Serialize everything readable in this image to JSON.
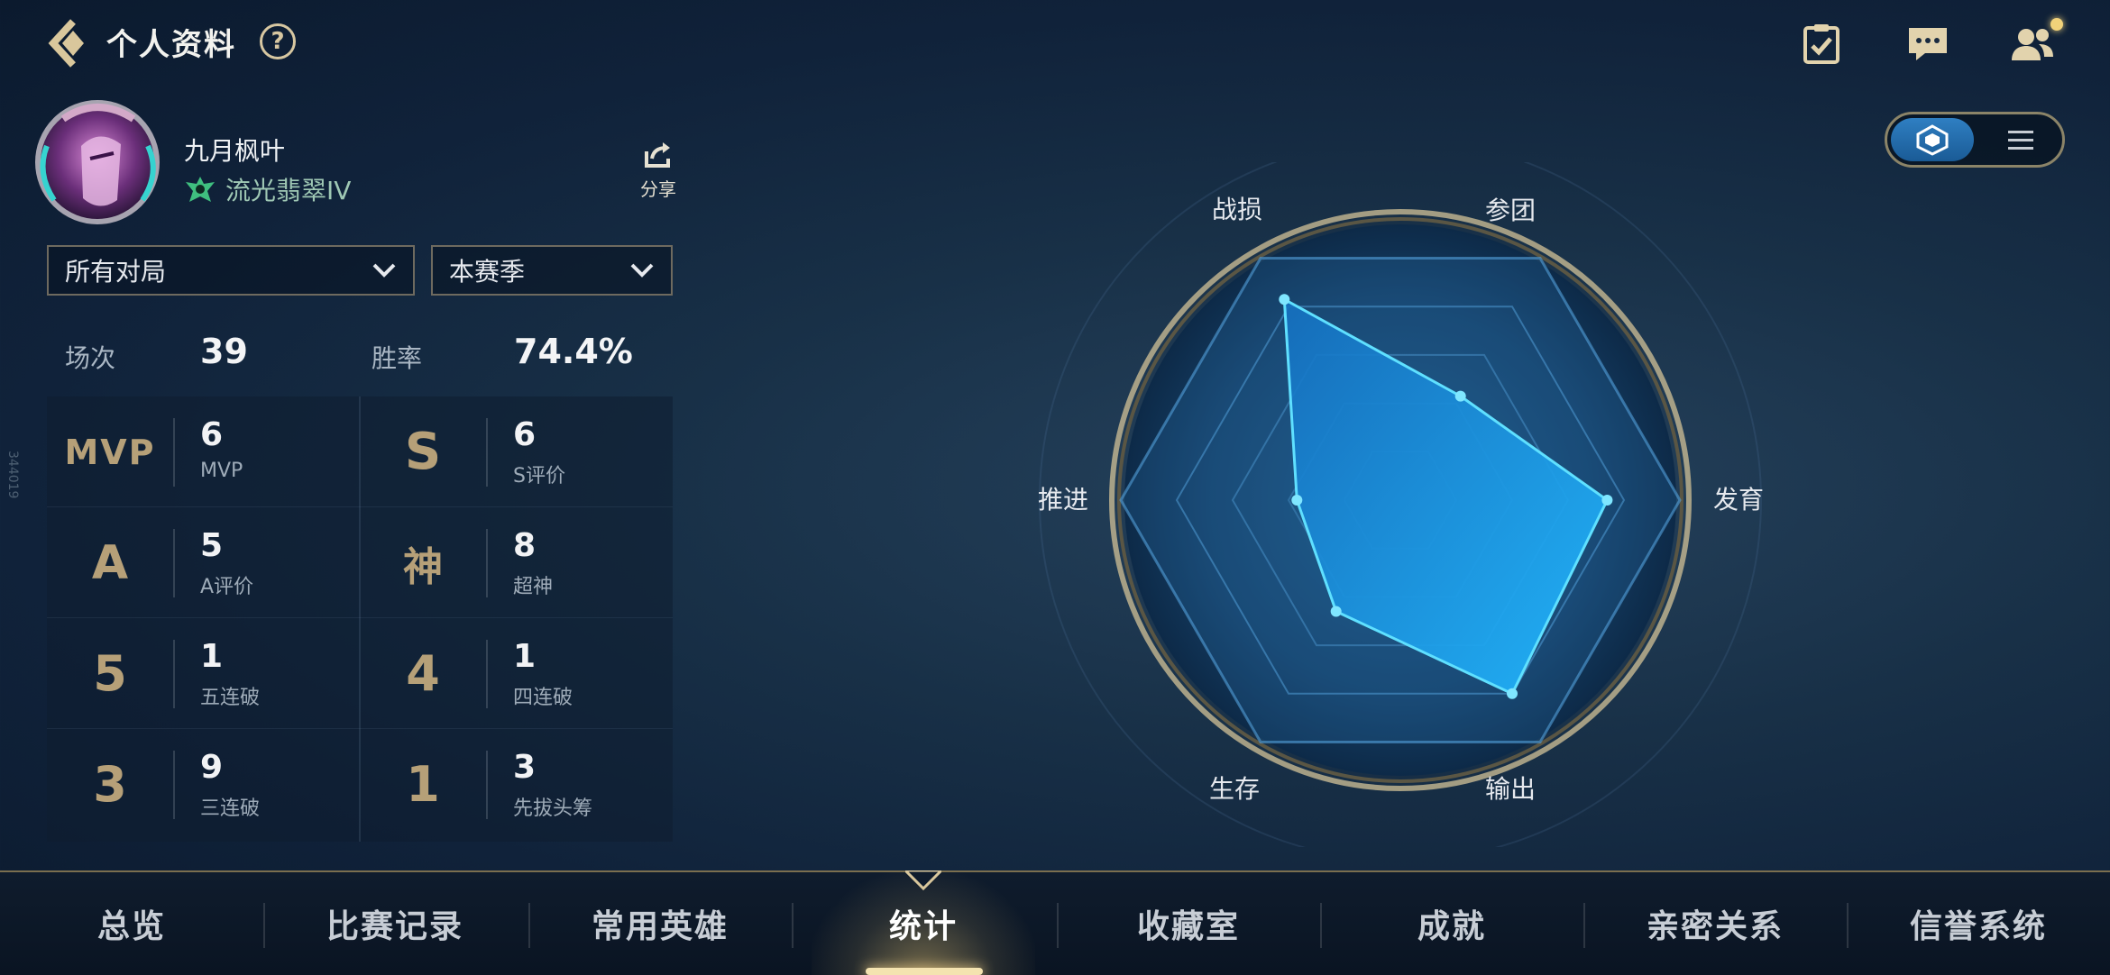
{
  "header": {
    "title": "个人资料",
    "help_glyph": "?",
    "icons": [
      "back-arrow-icon",
      "clipboard-check-icon",
      "chat-icon",
      "friends-icon"
    ]
  },
  "profile": {
    "name": "九月枫叶",
    "rank": "流光翡翠IV",
    "share_label": "分享"
  },
  "filters": {
    "mode": "所有对局",
    "season": "本赛季"
  },
  "summary": {
    "matches_label": "场次",
    "matches_value": "39",
    "winrate_label": "胜率",
    "winrate_value": "74.4%"
  },
  "stats": [
    {
      "icon": "MVP",
      "value": "6",
      "label": "MVP"
    },
    {
      "icon": "S",
      "value": "6",
      "label": "S评价"
    },
    {
      "icon": "A",
      "value": "5",
      "label": "A评价"
    },
    {
      "icon": "神",
      "value": "8",
      "label": "超神"
    },
    {
      "icon": "5",
      "value": "1",
      "label": "五连破"
    },
    {
      "icon": "4",
      "value": "1",
      "label": "四连破"
    },
    {
      "icon": "3",
      "value": "9",
      "label": "三连破"
    },
    {
      "icon": "1",
      "value": "3",
      "label": "先拔头筹"
    }
  ],
  "side_id": "344019",
  "view_toggle": {
    "active": "radar",
    "options": [
      "radar-icon",
      "list-icon"
    ]
  },
  "chart_data": {
    "type": "radar",
    "axes": [
      "参团",
      "发育",
      "输出",
      "生存",
      "推进",
      "战损"
    ],
    "values": [
      0.43,
      0.74,
      0.8,
      0.46,
      0.37,
      0.83
    ],
    "max": 1,
    "colors": {
      "fill": "#1a8fe0",
      "stroke": "#5fe0ff"
    }
  },
  "nav": {
    "tabs": [
      "总览",
      "比赛记录",
      "常用英雄",
      "统计",
      "收藏室",
      "成就",
      "亲密关系",
      "信誉系统"
    ],
    "active": "统计"
  },
  "colors": {
    "accent_gold": "#d7c7a1",
    "text_muted": "#9eabb8",
    "rank_green": "#9fc8b4"
  }
}
